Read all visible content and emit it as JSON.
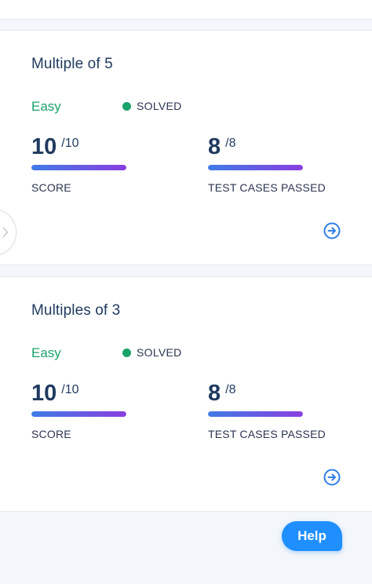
{
  "colors": {
    "title": "#1f3a5f",
    "easy": "#1aa36a",
    "solved_dot": "#1aa36a",
    "progress_start": "#3f7be6",
    "progress_end": "#8a3fe0",
    "help_bg": "#1f8fff",
    "arrow": "#2f7fe6"
  },
  "challenges": [
    {
      "title": "Multiple of 5",
      "difficulty": "Easy",
      "status": "SOLVED",
      "score": {
        "value": "10",
        "total": "/10",
        "label": "SCORE",
        "progress": 1.0
      },
      "tests": {
        "value": "8",
        "total": "/8",
        "label": "TEST CASES PASSED",
        "progress": 1.0
      },
      "open_icon": "arrow-circle-right-icon"
    },
    {
      "title": "Multiples of 3",
      "difficulty": "Easy",
      "status": "SOLVED",
      "score": {
        "value": "10",
        "total": "/10",
        "label": "SCORE",
        "progress": 1.0
      },
      "tests": {
        "value": "8",
        "total": "/8",
        "label": "TEST CASES PASSED",
        "progress": 1.0
      },
      "open_icon": "arrow-circle-right-icon"
    }
  ],
  "side_handle_icon": "chevron-right-icon",
  "help": {
    "label": "Help"
  }
}
